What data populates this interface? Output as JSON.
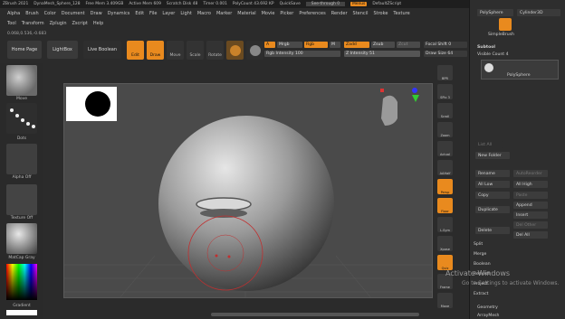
{
  "titlebar": {
    "app": "ZBrush 2021",
    "doc": "DynaMesh_Sphere_128",
    "free": "Free Mem 3.409GB",
    "active": "Active Mem 609",
    "scratch": "Scratch Disk 48",
    "timer": "Timer 0.001",
    "poly": "PolyCount 43.692 KP",
    "quicksave": "QuickSave",
    "see": "See-through 0",
    "menus": "Menus",
    "script": "DefaultZScript"
  },
  "menubar": [
    "Alpha",
    "Brush",
    "Color",
    "Document",
    "Draw",
    "Dynamics",
    "Edit",
    "File",
    "Layer",
    "Light",
    "Macro",
    "Marker",
    "Material",
    "Movie",
    "Picker",
    "Preferences",
    "Render",
    "Stencil",
    "Stroke",
    "Texture"
  ],
  "menubar2": [
    "Tool",
    "Transform",
    "Zplugin",
    "Zscript",
    "Help"
  ],
  "info": "0.068,0.536,-0.683",
  "toolbar": {
    "home": "Home Page",
    "lightbox": "LightBox",
    "live": "Live Boolean",
    "edit": "Edit",
    "draw": "Draw",
    "move": "Move",
    "scale": "Scale",
    "rotate": "Rotate",
    "a": "A",
    "mrgb": "Mrgb",
    "rgb": "Rgb",
    "m": "M",
    "zadd": "Zadd",
    "zsub": "Zsub",
    "zcut": "Zcut",
    "rgb_int": "Rgb Intensity 100",
    "z_int": "Z Intensity 51",
    "focal": "Focal Shift 0",
    "drawsize": "Draw Size 64",
    "dynamic": "Dynamic"
  },
  "left": {
    "move": "Move",
    "dots": "Dots",
    "alpha": "Alpha Off",
    "texture": "Texture Off",
    "matcap": "MatCap Gray",
    "gradient": "Gradient"
  },
  "rtools": [
    "BPR",
    "SPix 3",
    "Scroll",
    "Zoom",
    "Actual",
    "AAHalf",
    "Persp",
    "Floor",
    "L.Sym",
    "Xpose",
    "Qviz",
    "Frame",
    "Move"
  ],
  "rpanel": {
    "polysphere": "PolySphere",
    "cylinder": "Cylinder3D",
    "simplebrush": "SimpleBrush",
    "subtool": "Subtool",
    "visible": "Visible Count 4",
    "item": "PolySphere",
    "listall": "List All",
    "newfolder": "New Folder",
    "rename": "Rename",
    "autoreorder": "AutoReorder",
    "alllow": "All Low",
    "allhigh": "All High",
    "copy": "Copy",
    "paste": "Paste",
    "append": "Append",
    "duplicate": "Duplicate",
    "insert": "Insert",
    "delete": "Delete",
    "delother": "Del Other",
    "delall": "Del All",
    "split": "Split",
    "merge": "Merge",
    "boolean": "Boolean",
    "remesh": "Remesh",
    "project": "Project",
    "extract": "Extract",
    "geometry": "Geometry",
    "arraymesh": "ArrayMesh"
  },
  "watermark": {
    "line1": "Activate Windows",
    "line2": "Go to Settings to activate Windows."
  },
  "colors": {
    "accent": "#e98a1e",
    "bg": "#2b2b2b",
    "viewport": "#4a4a4a"
  }
}
